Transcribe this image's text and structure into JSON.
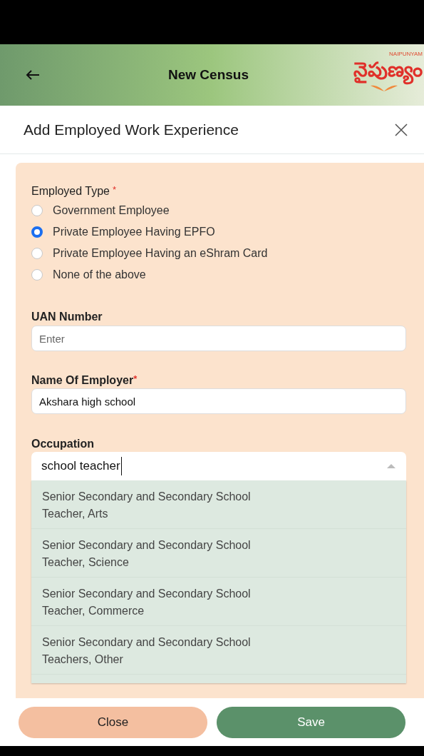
{
  "header": {
    "title": "New Census",
    "logo_text": "నైపుణ్యం",
    "logo_caption": "NAIPUNYAM"
  },
  "dialog": {
    "title": "Add Employed Work Experience"
  },
  "employed_type": {
    "label": "Employed Type",
    "required_mark": "*",
    "options": [
      {
        "label": "Government Employee",
        "selected": false
      },
      {
        "label": "Private Employee Having EPFO",
        "selected": true
      },
      {
        "label": "Private Employee Having an eShram Card",
        "selected": false
      },
      {
        "label": "None of the above",
        "selected": false
      }
    ]
  },
  "uan": {
    "label": "UAN Number",
    "placeholder": "Enter"
  },
  "employer": {
    "label": "Name Of Employer",
    "required_mark": "*",
    "value": "Akshara high school"
  },
  "occupation": {
    "label": "Occupation",
    "value": "school teacher",
    "expanded": true,
    "suggestions": [
      "Senior Secondary and Secondary School Teacher, Arts",
      "Senior Secondary and Secondary School Teacher, Science",
      "Senior Secondary and Secondary School Teacher, Commerce",
      "Senior Secondary and Secondary School Teachers, Other"
    ]
  },
  "buttons": [
    {
      "label": "Close",
      "kind": "secondary"
    },
    {
      "label": "Save",
      "kind": "primary"
    }
  ]
}
